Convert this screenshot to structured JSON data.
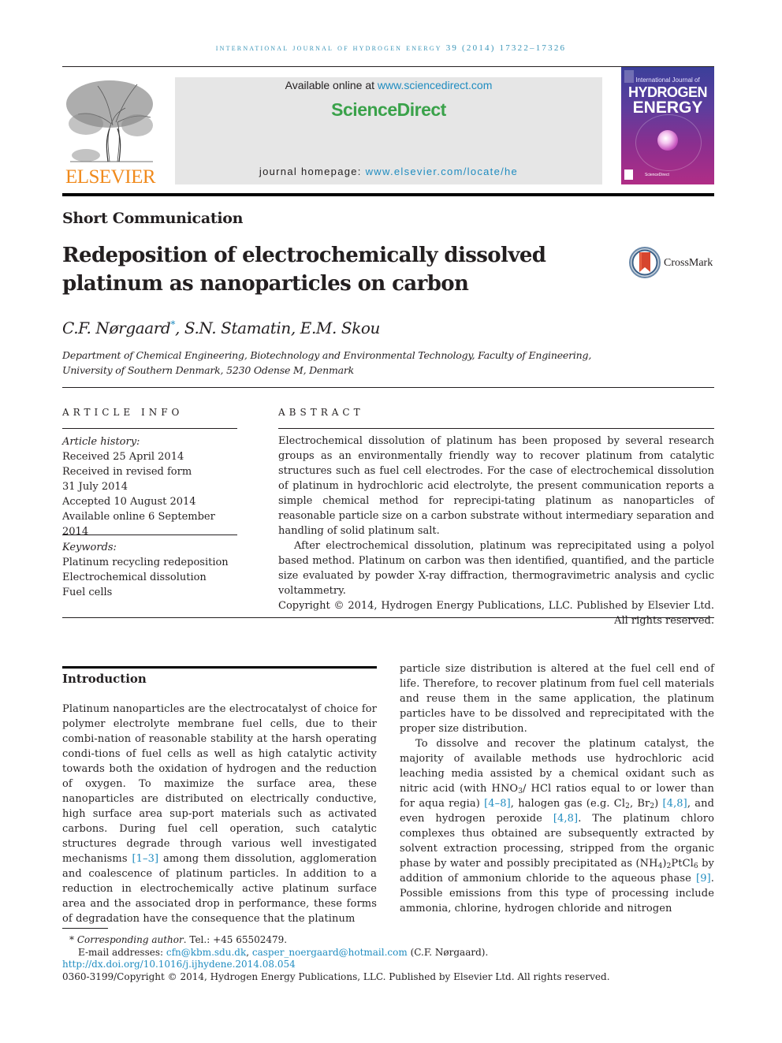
{
  "running_head": "International Journal of Hydrogen Energy 39 (2014) 17322–17326",
  "masthead": {
    "available_prefix": "Available online at ",
    "available_link": "www.sciencedirect.com",
    "brand": "ScienceDirect",
    "homepage_prefix": "journal homepage: ",
    "homepage_link": "www.elsevier.com/locate/he"
  },
  "publisher_logo": {
    "wordmark": "ELSEVIER",
    "color": "#f08a1c"
  },
  "cover": {
    "line1": "International Journal of",
    "line2": "HYDROGEN",
    "line3": "ENERGY",
    "footer": "ScienceDirect"
  },
  "article": {
    "type": "Short Communication",
    "title": "Redeposition of electrochemically dissolved platinum as nanoparticles on carbon",
    "crossmark_label": "CrossMark",
    "authors": [
      {
        "name": "C.F. Nørgaard",
        "mark": "*"
      },
      {
        "name": "S.N. Stamatin",
        "mark": ""
      },
      {
        "name": "E.M. Skou",
        "mark": ""
      }
    ],
    "affiliation_line1": "Department of Chemical Engineering, Biotechnology and Environmental Technology, Faculty of Engineering,",
    "affiliation_line2": "University of Southern Denmark, 5230 Odense M, Denmark"
  },
  "article_info": {
    "heading": "ARTICLE INFO",
    "history_label": "Article history:",
    "history": [
      "Received 25 April 2014",
      "Received in revised form",
      "31 July 2014",
      "Accepted 10 August 2014",
      "Available online 6 September 2014"
    ],
    "keywords_label": "Keywords:",
    "keywords": [
      "Platinum recycling redeposition",
      "Electrochemical dissolution",
      "Fuel cells"
    ]
  },
  "abstract": {
    "heading": "ABSTRACT",
    "paragraph1": "Electrochemical dissolution of platinum has been proposed by several research groups as an environmentally friendly way to recover platinum from catalytic structures such as fuel cell electrodes. For the case of electrochemical dissolution of platinum in hydrochloric acid electrolyte, the present communication reports a simple chemical method for reprecipi-tating platinum as nanoparticles of reasonable particle size on a carbon substrate without intermediary separation and handling of solid platinum salt.",
    "paragraph2": "After electrochemical dissolution, platinum was reprecipitated using a polyol based method. Platinum on carbon was then identified, quantified, and the particle size evaluated by powder X-ray diffraction, thermogravimetric analysis and cyclic voltammetry.",
    "copyright": "Copyright © 2014, Hydrogen Energy Publications, LLC. Published by Elsevier Ltd. All rights reserved."
  },
  "body": {
    "intro_heading": "Introduction",
    "left": {
      "p1_a": "Platinum nanoparticles are the electrocatalyst of choice for polymer electrolyte membrane fuel cells, due to their combi-nation of reasonable stability at the harsh operating condi-tions of fuel cells as well as high catalytic activity towards both the oxidation of hydrogen and the reduction of oxygen. To maximize the surface area, these nanoparticles are distributed on electrically conductive, high surface area sup-port materials such as activated carbons. During fuel cell operation, such catalytic structures degrade through various well investigated mechanisms ",
      "cite1": "[1–3]",
      "p1_b": " among them dissolution, agglomeration and coalescence of platinum particles. In addition to a reduction in electrochemically active platinum surface area and the associated drop in performance, these forms of degradation have the consequence that the platinum"
    },
    "right": {
      "p1": "particle size distribution is altered at the fuel cell end of life. Therefore, to recover platinum from fuel cell materials and reuse them in the same application, the platinum particles have to be dissolved and reprecipitated with the proper size distribution.",
      "p2_a": "To dissolve and recover the platinum catalyst, the majority of available methods use hydrochloric acid leaching media assisted by a chemical oxidant such as nitric acid (with HNO",
      "p2_sub1": "3",
      "p2_b": "/ HCl ratios equal to or lower than for aqua regia) ",
      "cite2": "[4–8]",
      "p2_c": ", halogen gas (e.g. Cl",
      "p2_sub2": "2",
      "p2_d": ", Br",
      "p2_sub3": "2",
      "p2_e": ") ",
      "cite3": "[4,8]",
      "p2_f": ", and even hydrogen peroxide ",
      "cite4": "[4,8]",
      "p2_g": ". The platinum chloro complexes thus obtained are subsequently extracted by solvent extraction processing, stripped from the organic phase by water and possibly precipitated as (NH",
      "p2_sub4": "4",
      "p2_h": ")",
      "p2_sub5": "2",
      "p2_i": "PtCl",
      "p2_sub6": "6",
      "p2_j": " by addition of ammonium chloride to the aqueous phase ",
      "cite5": "[9]",
      "p2_k": ". Possible emissions from this type of processing include ammonia, chlorine, hydrogen chloride and nitrogen"
    }
  },
  "footnotes": {
    "star": "*",
    "corresponding_label": "Corresponding author",
    "tel": ". Tel.: +45 65502479.",
    "email_label": "E-mail addresses: ",
    "email1": "cfn@kbm.sdu.dk",
    "email_sep": ", ",
    "email2": "casper_noergaard@hotmail.com",
    "email_owner": " (C.F. Nørgaard).",
    "doi": "http://dx.doi.org/10.1016/j.ijhydene.2014.08.054",
    "copyright": "0360-3199/Copyright © 2014, Hydrogen Energy Publications, LLC. Published by Elsevier Ltd. All rights reserved."
  },
  "colors": {
    "link": "#1f8cc0",
    "running_head": "#3a95b8",
    "sciencedirect_green": "#3aa24a",
    "masthead_bg": "#e6e6e6"
  }
}
